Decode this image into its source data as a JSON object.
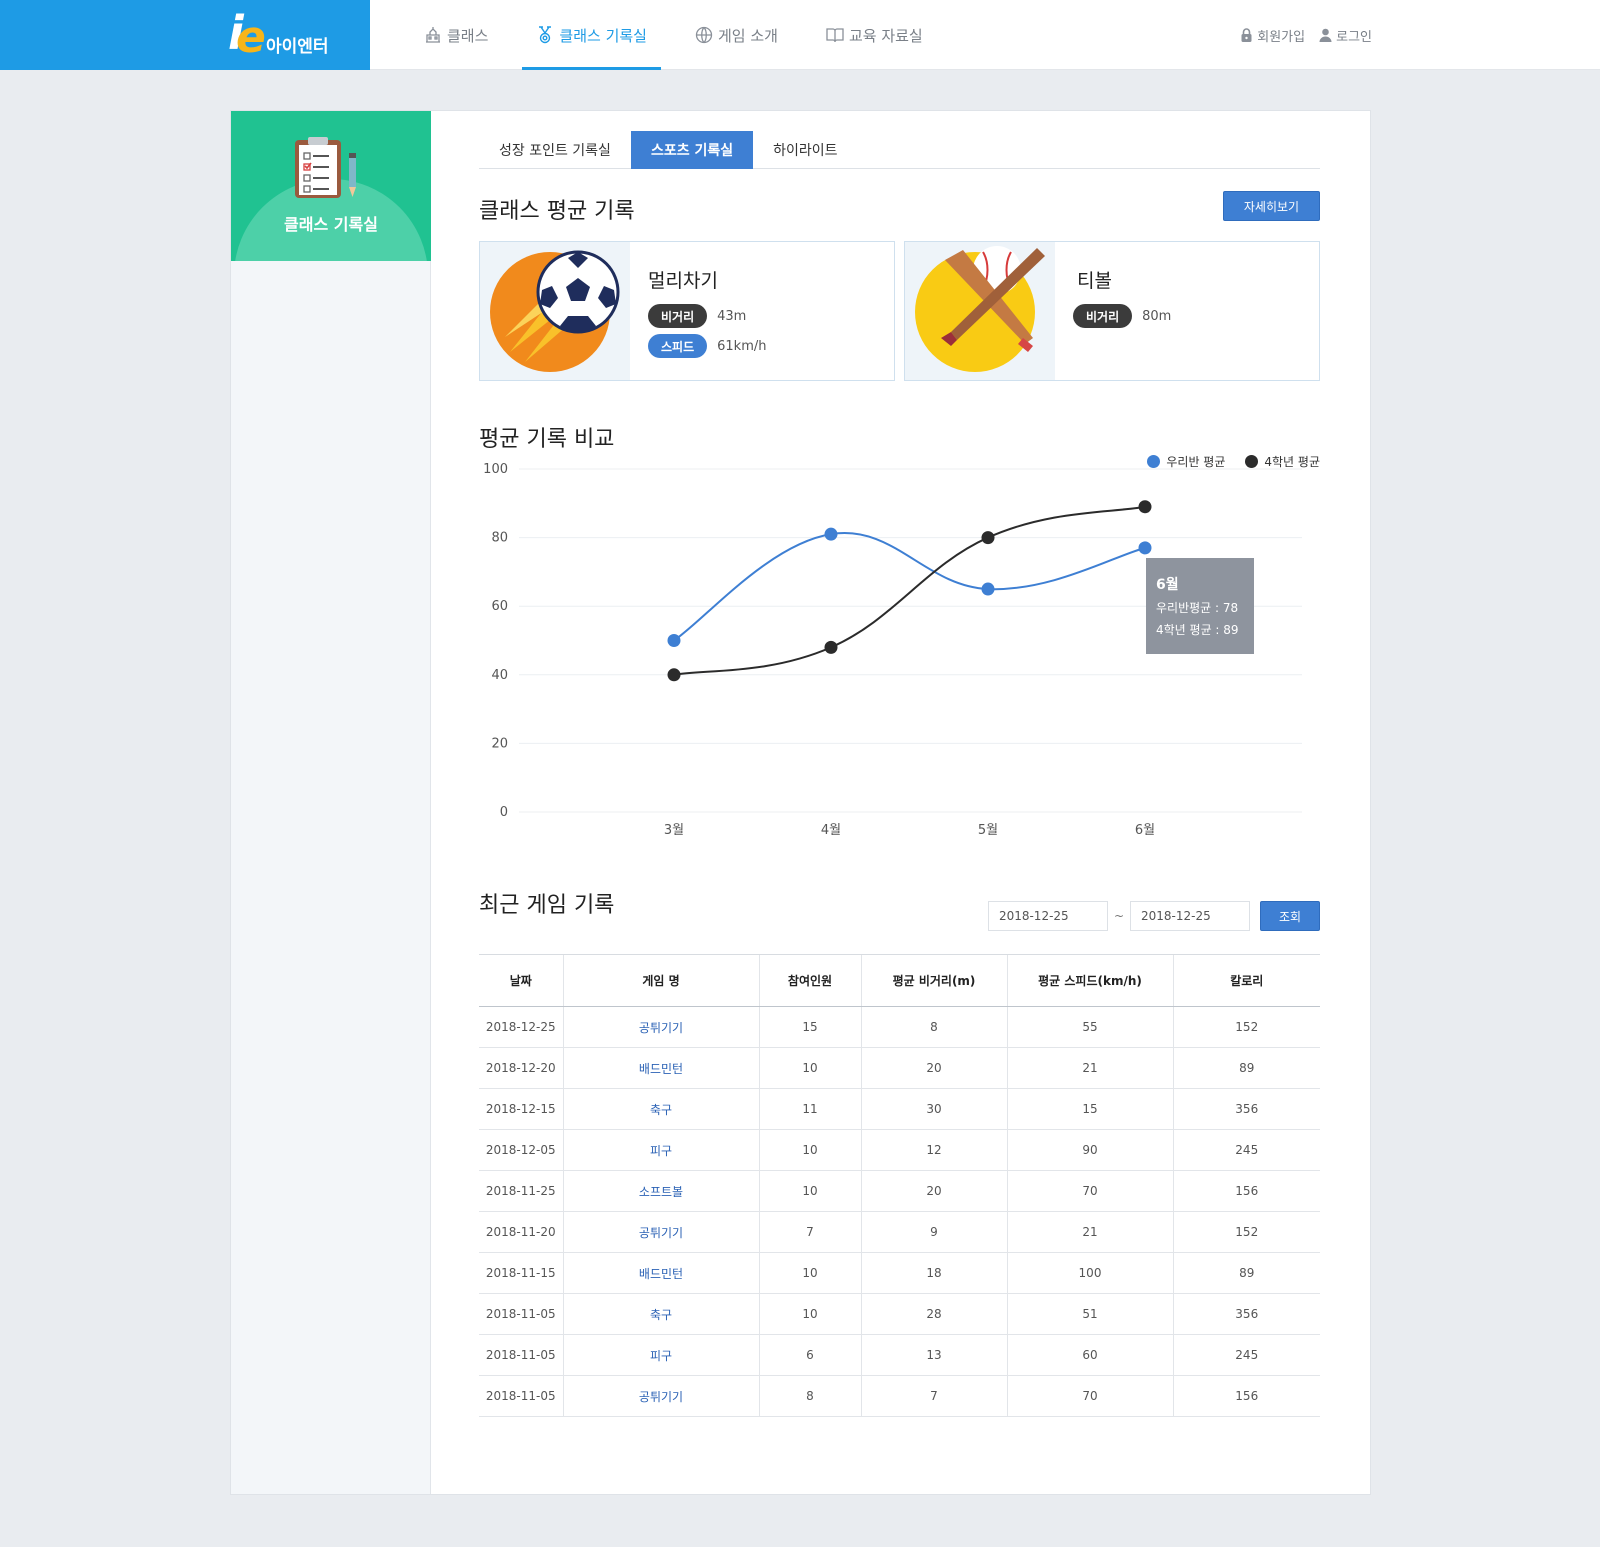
{
  "header": {
    "logo_text": "아이엔터",
    "nav": [
      "클래스",
      "클래스 기록실",
      "게임 소개",
      "교육 자료실"
    ],
    "auth": {
      "signup": "회원가입",
      "login": "로그인"
    }
  },
  "sidebar": {
    "title": "클래스 기록실"
  },
  "tabs": [
    "성장 포인트 기록실",
    "스포츠 기록실",
    "하이라이트"
  ],
  "avg_section": {
    "title": "클래스 평균 기록",
    "detail_button": "자세히보기",
    "cards": [
      {
        "name": "멀리차기",
        "stats": [
          {
            "label": "비거리",
            "value": "43m"
          },
          {
            "label": "스피드",
            "value": "61km/h"
          }
        ]
      },
      {
        "name": "티볼",
        "stats": [
          {
            "label": "비거리",
            "value": "80m"
          }
        ]
      }
    ]
  },
  "compare_section": {
    "title": "평균 기록 비교"
  },
  "chart_data": {
    "type": "line",
    "categories": [
      "3월",
      "4월",
      "5월",
      "6월"
    ],
    "series": [
      {
        "name": "우리반 평균",
        "values": [
          50,
          81,
          65,
          77
        ],
        "color": "#3e7fd3"
      },
      {
        "name": "4학년 평균",
        "values": [
          40,
          48,
          80,
          89
        ],
        "color": "#2b2b2b"
      }
    ],
    "ylim": [
      0,
      100
    ],
    "yticks": [
      0,
      20,
      40,
      60,
      80,
      100
    ],
    "grid": true,
    "legend": "top-right",
    "tooltip": {
      "title": "6월",
      "line1": "우리반평균 : 78",
      "line2": "4학년 평균 : 89"
    }
  },
  "records_section": {
    "title": "최근 게임 기록",
    "date_from": "2018-12-25",
    "date_to": "2018-12-25",
    "search_button": "조회",
    "columns": [
      "날짜",
      "게임 명",
      "참여인원",
      "평균 비거리(m)",
      "평균 스피드(km/h)",
      "칼로리"
    ],
    "rows": [
      [
        "2018-12-25",
        "공튀기기",
        "15",
        "8",
        "55",
        "152"
      ],
      [
        "2018-12-20",
        "배드민턴",
        "10",
        "20",
        "21",
        "89"
      ],
      [
        "2018-12-15",
        "축구",
        "11",
        "30",
        "15",
        "356"
      ],
      [
        "2018-12-05",
        "피구",
        "10",
        "12",
        "90",
        "245"
      ],
      [
        "2018-11-25",
        "소프트볼",
        "10",
        "20",
        "70",
        "156"
      ],
      [
        "2018-11-20",
        "공튀기기",
        "7",
        "9",
        "21",
        "152"
      ],
      [
        "2018-11-15",
        "배드민턴",
        "10",
        "18",
        "100",
        "89"
      ],
      [
        "2018-11-05",
        "축구",
        "10",
        "28",
        "51",
        "356"
      ],
      [
        "2018-11-05",
        "피구",
        "6",
        "13",
        "60",
        "245"
      ],
      [
        "2018-11-05",
        "공튀기기",
        "8",
        "7",
        "70",
        "156"
      ]
    ]
  }
}
